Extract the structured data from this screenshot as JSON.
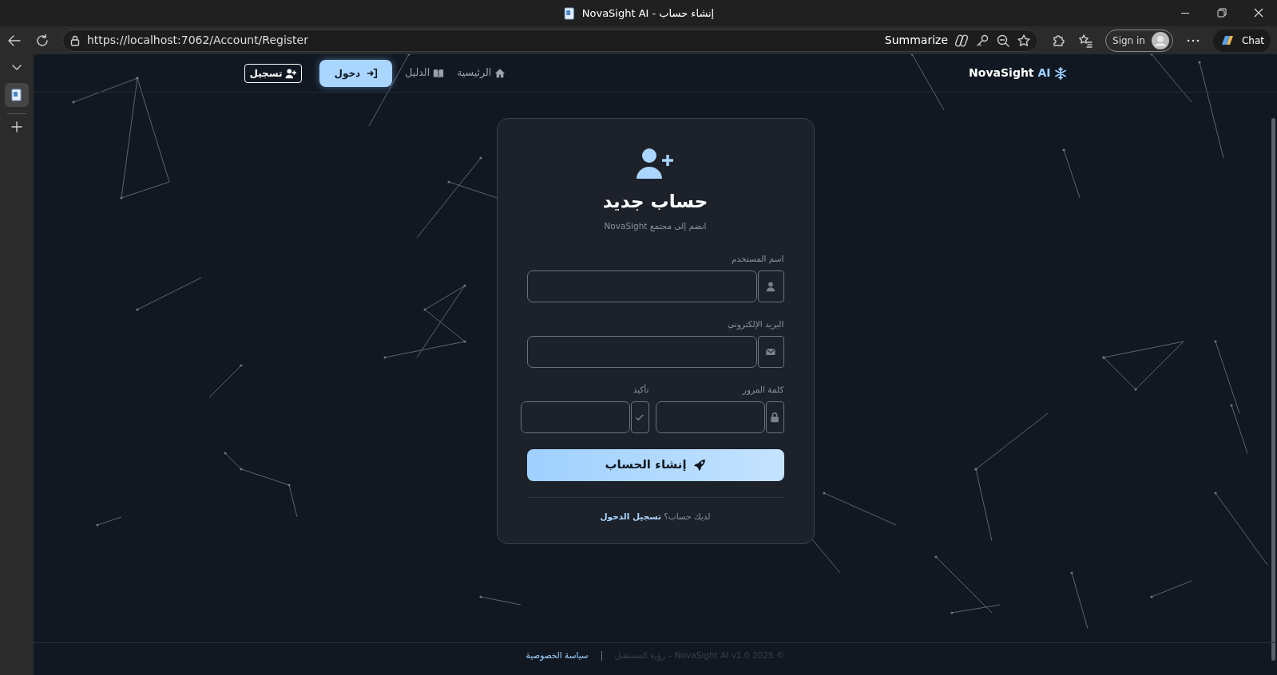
{
  "browser": {
    "tab_title": "إنشاء حساب - NovaSight AI",
    "url": "https://localhost:7062/Account/Register",
    "summarize": "Summarize",
    "sign_in": "Sign in",
    "chat": "Chat"
  },
  "navbar": {
    "brand_name": "NovaSight",
    "brand_suffix": "AI",
    "links": [
      {
        "label": "الرئيسية",
        "kind": "link"
      },
      {
        "label": "الدليل",
        "kind": "link"
      },
      {
        "label": "دخول",
        "kind": "filled"
      },
      {
        "label": "تسجيل",
        "kind": "outline"
      }
    ]
  },
  "card": {
    "title": "حساب جديد",
    "subtitle": "انضم إلى مجتمع NovaSight",
    "fields": [
      {
        "label": "اسم المستخدم",
        "kind": "full"
      },
      {
        "label": "البريد الإلكتروني",
        "kind": "full"
      },
      {
        "label": "كلمة المرور",
        "kind": "half"
      },
      {
        "label": "تأكيد",
        "kind": "half"
      }
    ],
    "submit": "إنشاء الحساب",
    "prompt": "لديك حساب؟ **تسجيل الدخول**"
  },
  "footer": {
    "privacy_link": "سياسة الخصوصية",
    "copyright": "© 2025 NovaSight AI v1.0 – رؤية المستقبل"
  }
}
